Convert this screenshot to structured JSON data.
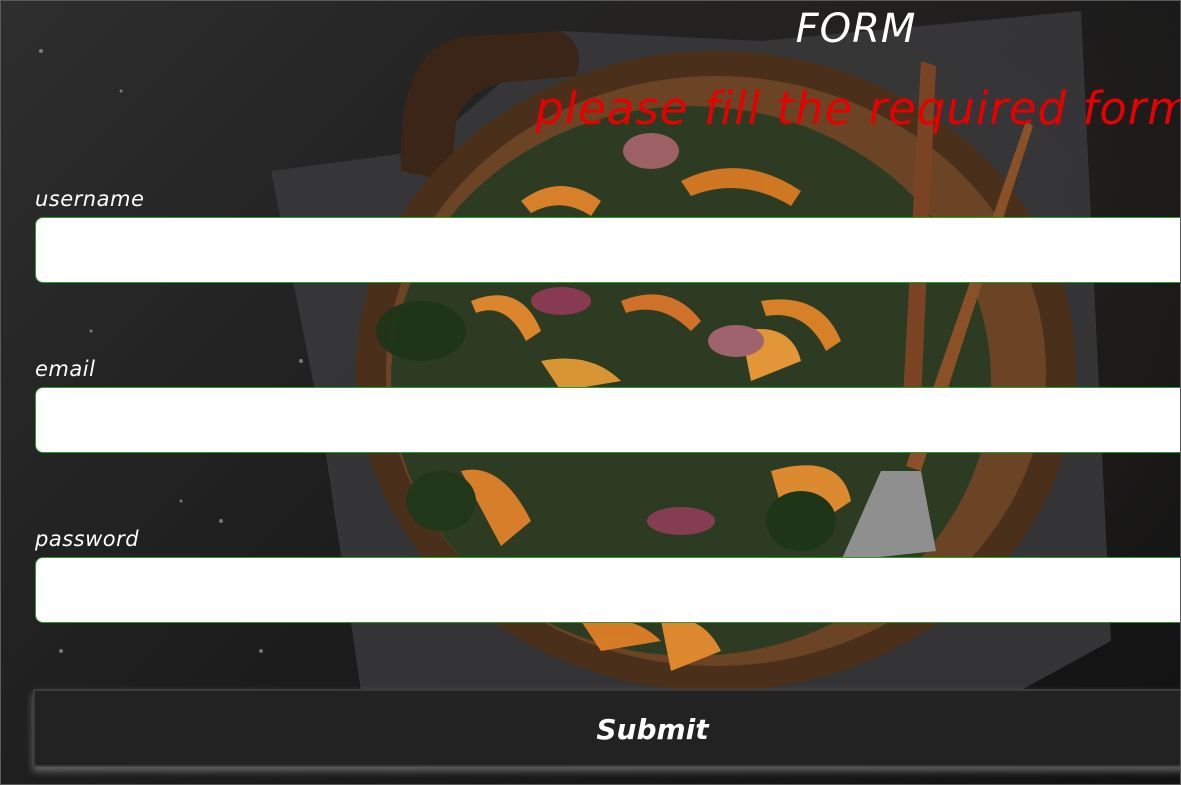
{
  "form": {
    "title": "FORM",
    "notice": "please fill the required form.",
    "fields": [
      {
        "label": "username",
        "value": "",
        "placeholder": ""
      },
      {
        "label": "email",
        "value": "",
        "placeholder": ""
      },
      {
        "label": "password",
        "value": "",
        "placeholder": ""
      }
    ],
    "submit_label": "Submit"
  },
  "colors": {
    "notice": "#e60000",
    "field_border": "#2e9a2e",
    "submit_bg": "#222222"
  }
}
